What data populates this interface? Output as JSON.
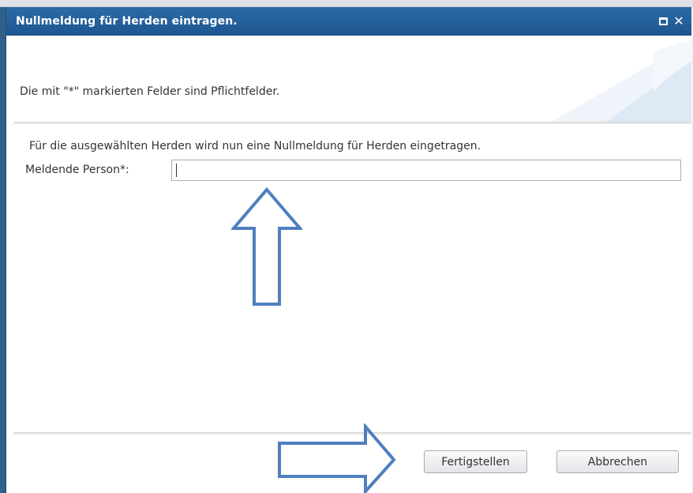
{
  "dialog": {
    "title": "Nullmeldung für Herden eintragen.",
    "maximize_icon": "maximize-icon",
    "close_icon": "close-icon",
    "close_glyph": "✕",
    "required_hint": "Die mit \"*\" markierten Felder sind Pflichtfelder.",
    "description": "Für die ausgewählten Herden wird nun eine Nullmeldung für Herden eingetragen.",
    "field": {
      "label": "Meldende Person*:",
      "value": "",
      "placeholder": ""
    },
    "buttons": {
      "finish": "Fertigstellen",
      "cancel": "Abbrechen"
    }
  },
  "annotations": {
    "up_arrow_icon": "arrow-up-outline-icon",
    "right_arrow_icon": "arrow-right-outline-icon",
    "color": "#4f7fbf"
  },
  "colors": {
    "titlebar": "#1d5791",
    "title_text": "#ffffff",
    "text": "#333333",
    "swoosh": "#dde9f4"
  }
}
